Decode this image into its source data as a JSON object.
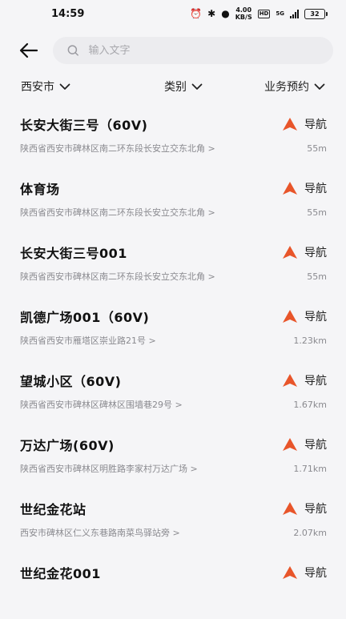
{
  "status": {
    "time": "14:59",
    "net_speed": "4.00",
    "net_unit": "KB/S",
    "hd": "HD",
    "signal": "5G",
    "battery": "32"
  },
  "search": {
    "placeholder": "输入文字"
  },
  "filters": {
    "city": "西安市",
    "category": "类别",
    "booking": "业务预约"
  },
  "nav_label": "导航",
  "accent": "#e8552a",
  "stations": [
    {
      "name": "长安大街三号（60V)",
      "address": "陕西省西安市碑林区南二环东段长安立交东北角 >",
      "distance": "55m"
    },
    {
      "name": "体育场",
      "address": "陕西省西安市碑林区南二环东段长安立交东北角 >",
      "distance": "55m"
    },
    {
      "name": "长安大街三号001",
      "address": "陕西省西安市碑林区南二环东段长安立交东北角 >",
      "distance": "55m"
    },
    {
      "name": "凯德广场001（60V)",
      "address": "陕西省西安市雁塔区崇业路21号 >",
      "distance": "1.23km"
    },
    {
      "name": "望城小区（60V)",
      "address": "陕西省西安市碑林区碑林区围墙巷29号 >",
      "distance": "1.67km"
    },
    {
      "name": "万达广场(60V)",
      "address": "陕西省西安市碑林区明胜路李家村万达广场 >",
      "distance": "1.71km"
    },
    {
      "name": "世纪金花站",
      "address": "西安市碑林区仁义东巷路南菜鸟驿站旁 >",
      "distance": "2.07km"
    },
    {
      "name": "世纪金花001",
      "address": "",
      "distance": ""
    }
  ]
}
